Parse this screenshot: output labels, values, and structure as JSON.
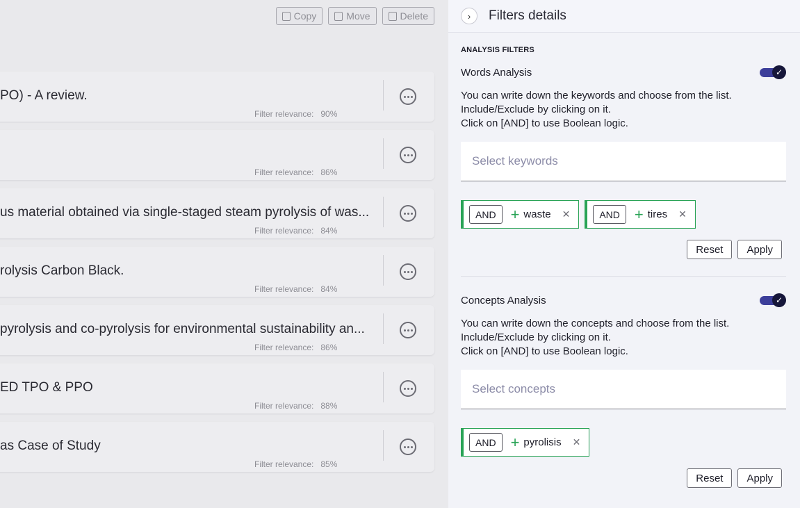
{
  "toolbar": {
    "copy": "Copy",
    "move": "Move",
    "delete": "Delete"
  },
  "results": [
    {
      "title": "PO) - A review.",
      "relevance_label": "Filter relevance:",
      "relevance": "90%"
    },
    {
      "title": "",
      "relevance_label": "Filter relevance:",
      "relevance": "86%"
    },
    {
      "title": "us material obtained via single-staged steam pyrolysis of was...",
      "relevance_label": "Filter relevance:",
      "relevance": "84%"
    },
    {
      "title": "rolysis Carbon Black.",
      "relevance_label": "Filter relevance:",
      "relevance": "84%"
    },
    {
      "title": "pyrolysis and co-pyrolysis for environmental sustainability an...",
      "relevance_label": "Filter relevance:",
      "relevance": "86%"
    },
    {
      "title": "ED TPO & PPO",
      "relevance_label": "Filter relevance:",
      "relevance": "88%"
    },
    {
      "title": "as Case of Study",
      "relevance_label": "Filter relevance:",
      "relevance": "85%"
    }
  ],
  "panel": {
    "title": "Filters details",
    "section_label": "ANALYSIS FILTERS",
    "words": {
      "name": "Words Analysis",
      "help": [
        "You can write down the keywords and choose from the list.",
        "Include/Exclude by clicking on it.",
        "Click on [AND] to use Boolean logic."
      ],
      "placeholder": "Select keywords",
      "chips": [
        {
          "op": "AND",
          "sign": "+",
          "word": "waste"
        },
        {
          "op": "AND",
          "sign": "+",
          "word": "tires"
        }
      ],
      "reset": "Reset",
      "apply": "Apply"
    },
    "concepts": {
      "name": "Concepts Analysis",
      "help": [
        "You can write down the concepts and choose from the list.",
        "Include/Exclude by clicking on it.",
        "Click on [AND] to use Boolean logic."
      ],
      "placeholder": "Select concepts",
      "chips": [
        {
          "op": "AND",
          "sign": "+",
          "word": "pyrolisis"
        }
      ],
      "reset": "Reset",
      "apply": "Apply"
    }
  },
  "colors": {
    "toggle_track": "#3c3e9a",
    "include_green": "#29a356"
  }
}
